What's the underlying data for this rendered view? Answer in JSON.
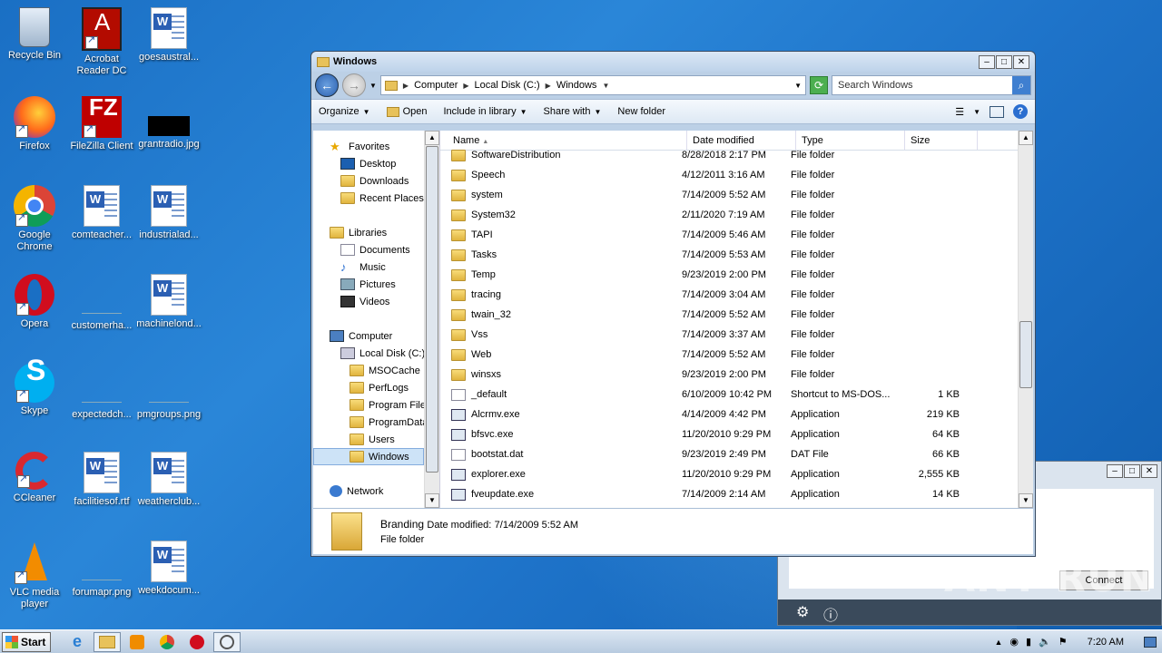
{
  "desktop": {
    "icons": [
      {
        "label": "Recycle Bin"
      },
      {
        "label": "Acrobat Reader DC"
      },
      {
        "label": "goesaustral..."
      },
      {
        "label": "Firefox"
      },
      {
        "label": "FileZilla Client"
      },
      {
        "label": "grantradio.jpg"
      },
      {
        "label": "Google Chrome"
      },
      {
        "label": "comteacher..."
      },
      {
        "label": "industrialad..."
      },
      {
        "label": "Opera"
      },
      {
        "label": "customerha..."
      },
      {
        "label": "machinelond..."
      },
      {
        "label": "Skype"
      },
      {
        "label": "expectedch..."
      },
      {
        "label": "pmgroups.png"
      },
      {
        "label": "CCleaner"
      },
      {
        "label": "facilitiesof.rtf"
      },
      {
        "label": "weatherclub..."
      },
      {
        "label": "VLC media player"
      },
      {
        "label": "forumapr.png"
      },
      {
        "label": "weekdocum..."
      }
    ]
  },
  "explorer": {
    "title": "Windows",
    "breadcrumb": [
      "Computer",
      "Local Disk (C:)",
      "Windows"
    ],
    "search_placeholder": "Search Windows",
    "toolbar": {
      "organize": "Organize",
      "open": "Open",
      "include": "Include in library",
      "share": "Share with",
      "newfolder": "New folder"
    },
    "nav": {
      "favorites": "Favorites",
      "desktop": "Desktop",
      "downloads": "Downloads",
      "recent": "Recent Places",
      "libraries": "Libraries",
      "documents": "Documents",
      "music": "Music",
      "pictures": "Pictures",
      "videos": "Videos",
      "computer": "Computer",
      "localdisk": "Local Disk (C:)",
      "msocache": "MSOCache",
      "perflogs": "PerfLogs",
      "programfiles": "Program Files",
      "programdata": "ProgramData",
      "users": "Users",
      "windows": "Windows",
      "network": "Network"
    },
    "columns": {
      "name": "Name",
      "date": "Date modified",
      "type": "Type",
      "size": "Size"
    },
    "files": [
      {
        "name": "SoftwareDistribution",
        "date": "8/28/2018 2:17 PM",
        "type": "File folder",
        "size": "",
        "kind": "folder"
      },
      {
        "name": "Speech",
        "date": "4/12/2011 3:16 AM",
        "type": "File folder",
        "size": "",
        "kind": "folder"
      },
      {
        "name": "system",
        "date": "7/14/2009 5:52 AM",
        "type": "File folder",
        "size": "",
        "kind": "folder"
      },
      {
        "name": "System32",
        "date": "2/11/2020 7:19 AM",
        "type": "File folder",
        "size": "",
        "kind": "folder"
      },
      {
        "name": "TAPI",
        "date": "7/14/2009 5:46 AM",
        "type": "File folder",
        "size": "",
        "kind": "folder"
      },
      {
        "name": "Tasks",
        "date": "7/14/2009 5:53 AM",
        "type": "File folder",
        "size": "",
        "kind": "folder"
      },
      {
        "name": "Temp",
        "date": "9/23/2019 2:00 PM",
        "type": "File folder",
        "size": "",
        "kind": "folder"
      },
      {
        "name": "tracing",
        "date": "7/14/2009 3:04 AM",
        "type": "File folder",
        "size": "",
        "kind": "folder"
      },
      {
        "name": "twain_32",
        "date": "7/14/2009 5:52 AM",
        "type": "File folder",
        "size": "",
        "kind": "folder"
      },
      {
        "name": "Vss",
        "date": "7/14/2009 3:37 AM",
        "type": "File folder",
        "size": "",
        "kind": "folder"
      },
      {
        "name": "Web",
        "date": "7/14/2009 5:52 AM",
        "type": "File folder",
        "size": "",
        "kind": "folder"
      },
      {
        "name": "winsxs",
        "date": "9/23/2019 2:00 PM",
        "type": "File folder",
        "size": "",
        "kind": "folder"
      },
      {
        "name": "_default",
        "date": "6/10/2009 10:42 PM",
        "type": "Shortcut to MS-DOS...",
        "size": "1 KB",
        "kind": "file"
      },
      {
        "name": "Alcrmv.exe",
        "date": "4/14/2009 4:42 PM",
        "type": "Application",
        "size": "219 KB",
        "kind": "app"
      },
      {
        "name": "bfsvc.exe",
        "date": "11/20/2010 9:29 PM",
        "type": "Application",
        "size": "64 KB",
        "kind": "app"
      },
      {
        "name": "bootstat.dat",
        "date": "9/23/2019 2:49 PM",
        "type": "DAT File",
        "size": "66 KB",
        "kind": "file"
      },
      {
        "name": "explorer.exe",
        "date": "11/20/2010 9:29 PM",
        "type": "Application",
        "size": "2,555 KB",
        "kind": "app"
      },
      {
        "name": "fveupdate.exe",
        "date": "7/14/2009 2:14 AM",
        "type": "Application",
        "size": "14 KB",
        "kind": "app"
      }
    ],
    "details": {
      "name": "Branding",
      "modified_label": "Date modified:",
      "modified_value": "7/14/2009 5:52 AM",
      "type": "File folder"
    }
  },
  "cisco": {
    "connect_label": "Connect"
  },
  "taskbar": {
    "start_label": "Start",
    "time": "7:20 AM"
  },
  "watermark": "ANY RUN"
}
